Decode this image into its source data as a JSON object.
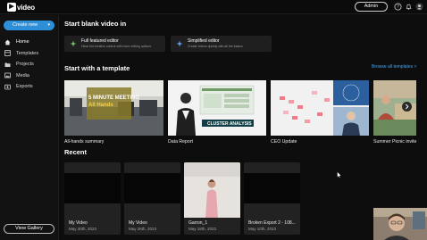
{
  "topbar": {
    "logo_text": "video",
    "admin_label": "Admin",
    "icons": [
      "help-icon",
      "bell-icon",
      "user-avatar"
    ]
  },
  "sidebar": {
    "create_label": "Create new",
    "items": [
      {
        "label": "Home",
        "icon": "home-icon",
        "active": true
      },
      {
        "label": "Templates",
        "icon": "templates-icon",
        "active": false
      },
      {
        "label": "Projects",
        "icon": "folder-icon",
        "active": false
      },
      {
        "label": "Media",
        "icon": "media-icon",
        "active": false
      },
      {
        "label": "Exports",
        "icon": "export-icon",
        "active": false
      }
    ],
    "gallery_label": "View Gallery"
  },
  "blank": {
    "title": "Start blank video in",
    "cards": [
      {
        "title": "Full featured editor",
        "subtitle": "Have full creative control with more editing options.",
        "icon_color": "#7fd36b"
      },
      {
        "title": "Simplified editor",
        "subtitle": "Create videos quickly with all the basics.",
        "icon_color": "#6aa9ff"
      }
    ]
  },
  "templates": {
    "title": "Start with a template",
    "browse_label": "Browse all templates >",
    "items": [
      {
        "label": "All-hands summary",
        "thumb_text": "5 MINUTE MEETING",
        "thumb_sub": "All Hands"
      },
      {
        "label": "Data Report",
        "thumb_text": "CLUSTER ANALYSIS"
      },
      {
        "label": "CEO Update"
      },
      {
        "label": "Summer Picnic invite"
      }
    ]
  },
  "recent": {
    "title": "Recent",
    "items": [
      {
        "name": "My Video",
        "date": "May 30th, 2023"
      },
      {
        "name": "My Video",
        "date": "May 26th, 2023"
      },
      {
        "name": "Garron_1",
        "date": "May 18th, 2023"
      },
      {
        "name": "Broken Export 2 - 108...",
        "date": "May 10th, 2023"
      }
    ]
  }
}
